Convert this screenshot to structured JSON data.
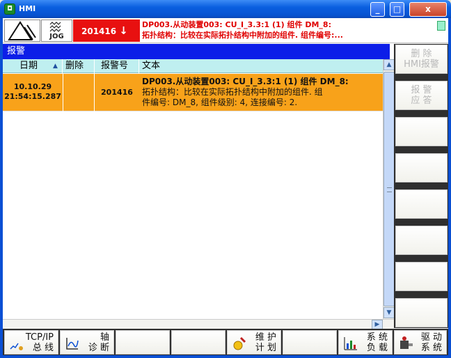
{
  "window": {
    "title": "HMI",
    "minimize_label": "_",
    "maximize_label": "□",
    "close_label": "x"
  },
  "header": {
    "mode": "JOG",
    "alarm_number": "201416",
    "alarm_arrow": "↓",
    "message_line1": "DP003.从动装置003: CU_I_3.3:1 (1) 组件 DM_8:",
    "message_line2": "拓扑结构：比较在实际拓扑结构中附加的组件. 组件编号:..."
  },
  "section_title": "报警",
  "table": {
    "columns": [
      {
        "label": "日期",
        "sort_icon": "▲"
      },
      {
        "label": "删除"
      },
      {
        "label": "报警号"
      },
      {
        "label": "文本"
      }
    ],
    "rows": [
      {
        "date": "10.10.29",
        "time": "21:54:15.287",
        "delete": "",
        "alarm_no": "201416",
        "text_line1": "DP003.从动装置003: CU_I_3.3:1 (1) 组件 DM_8:",
        "text_line2": "拓扑结构：比较在实际拓扑结构中附加的组件. 组",
        "text_line3": "件编号: DM_8, 组件级别: 4, 连接编号: 2."
      }
    ]
  },
  "right_softkeys": [
    {
      "line1": "删 除",
      "line2": "HMI报警"
    },
    {
      "line1": "报 警",
      "line2": "应 答"
    },
    {
      "line1": "",
      "line2": ""
    },
    {
      "line1": "",
      "line2": ""
    },
    {
      "line1": "",
      "line2": ""
    },
    {
      "line1": "",
      "line2": ""
    },
    {
      "line1": "",
      "line2": ""
    },
    {
      "line1": "",
      "line2": ""
    }
  ],
  "bottom_softkeys": [
    {
      "line1": "TCP/IP",
      "line2": "总 线",
      "icon": "network-icon"
    },
    {
      "line1": "轴",
      "line2": "诊 断",
      "icon": "axis-icon"
    },
    {
      "line1": "",
      "line2": "",
      "icon": ""
    },
    {
      "line1": "",
      "line2": "",
      "icon": ""
    },
    {
      "line1": "维 护",
      "line2": "计 划",
      "icon": "maintenance-icon"
    },
    {
      "line1": "",
      "line2": "",
      "icon": ""
    },
    {
      "line1": "系 统",
      "line2": "负 载",
      "icon": "bar-chart-icon"
    },
    {
      "line1": "驱 动",
      "line2": "系 统",
      "icon": "drive-icon"
    }
  ],
  "colors": {
    "alarm_bg": "#e81010",
    "selected_row": "#f8a21a",
    "section_bar": "#0c1ee8",
    "header_row": "#bfeff0"
  }
}
